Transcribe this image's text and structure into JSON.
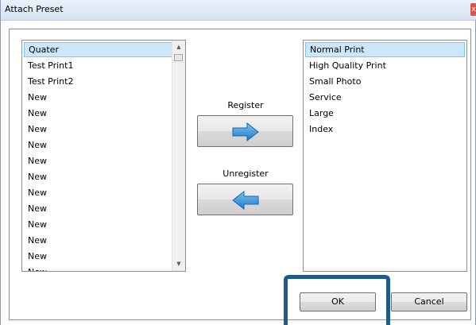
{
  "window": {
    "title": "Attach Preset",
    "close_glyph": "x"
  },
  "left_list": {
    "items": [
      "Quater",
      "Test Print1",
      "Test Print2",
      "New",
      "New",
      "New",
      "New",
      "New",
      "New",
      "New",
      "New",
      "New",
      "New",
      "New",
      "New"
    ],
    "selected_index": 0
  },
  "right_list": {
    "items": [
      "Normal Print",
      "High Quality Print",
      "Small Photo",
      "Service",
      "Large",
      "Index"
    ],
    "selected_index": 0
  },
  "register": {
    "label": "Register",
    "icon": "arrow-right-icon",
    "color": "#1e88d6"
  },
  "unregister": {
    "label": "Unregister",
    "icon": "arrow-left-icon",
    "color": "#1e88d6"
  },
  "buttons": {
    "ok": "OK",
    "cancel": "Cancel"
  },
  "accent": {
    "highlight_border": "#1f5a8e",
    "selection_bg": "#cce6fb"
  }
}
